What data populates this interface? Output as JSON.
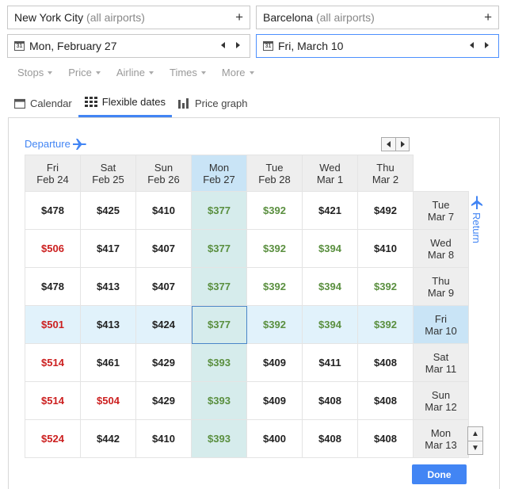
{
  "search": {
    "origin": {
      "city": "New York City",
      "suffix": "(all airports)"
    },
    "destination": {
      "city": "Barcelona",
      "suffix": "(all airports)"
    },
    "depart_date": "Mon, February 27",
    "return_date": "Fri, March 10",
    "calendar_icon_text": "31"
  },
  "filters": [
    "Stops",
    "Price",
    "Airline",
    "Times",
    "More"
  ],
  "tabs": [
    {
      "label": "Calendar",
      "icon": "calendar-icon"
    },
    {
      "label": "Flexible dates",
      "icon": "grid-icon",
      "active": true
    },
    {
      "label": "Price graph",
      "icon": "bar-chart-icon"
    }
  ],
  "grid": {
    "departure_label": "Departure",
    "return_label": "Return",
    "columns": [
      {
        "day": "Fri",
        "date": "Feb 24"
      },
      {
        "day": "Sat",
        "date": "Feb 25"
      },
      {
        "day": "Sun",
        "date": "Feb 26"
      },
      {
        "day": "Mon",
        "date": "Feb 27"
      },
      {
        "day": "Tue",
        "date": "Feb 28"
      },
      {
        "day": "Wed",
        "date": "Mar 1"
      },
      {
        "day": "Thu",
        "date": "Mar 2"
      }
    ],
    "rows": [
      {
        "day": "Tue",
        "date": "Mar 7",
        "prices": [
          "$478",
          "$425",
          "$410",
          "$377",
          "$392",
          "$421",
          "$492"
        ]
      },
      {
        "day": "Wed",
        "date": "Mar 8",
        "prices": [
          "$506",
          "$417",
          "$407",
          "$377",
          "$392",
          "$394",
          "$410"
        ]
      },
      {
        "day": "Thu",
        "date": "Mar 9",
        "prices": [
          "$478",
          "$413",
          "$407",
          "$377",
          "$392",
          "$394",
          "$392"
        ]
      },
      {
        "day": "Fri",
        "date": "Mar 10",
        "prices": [
          "$501",
          "$413",
          "$424",
          "$377",
          "$392",
          "$394",
          "$392"
        ]
      },
      {
        "day": "Sat",
        "date": "Mar 11",
        "prices": [
          "$514",
          "$461",
          "$429",
          "$393",
          "$409",
          "$411",
          "$408"
        ]
      },
      {
        "day": "Sun",
        "date": "Mar 12",
        "prices": [
          "$514",
          "$504",
          "$429",
          "$393",
          "$409",
          "$408",
          "$408"
        ]
      },
      {
        "day": "Mon",
        "date": "Mar 13",
        "prices": [
          "$524",
          "$442",
          "$410",
          "$393",
          "$400",
          "$408",
          "$408"
        ]
      }
    ],
    "selected_column": 3,
    "selected_row": 3,
    "colors": {
      "low": "#5a8f3f",
      "high": "#cc1f1f",
      "normal": "#222222",
      "accent": "#4285f4"
    }
  },
  "done_label": "Done"
}
